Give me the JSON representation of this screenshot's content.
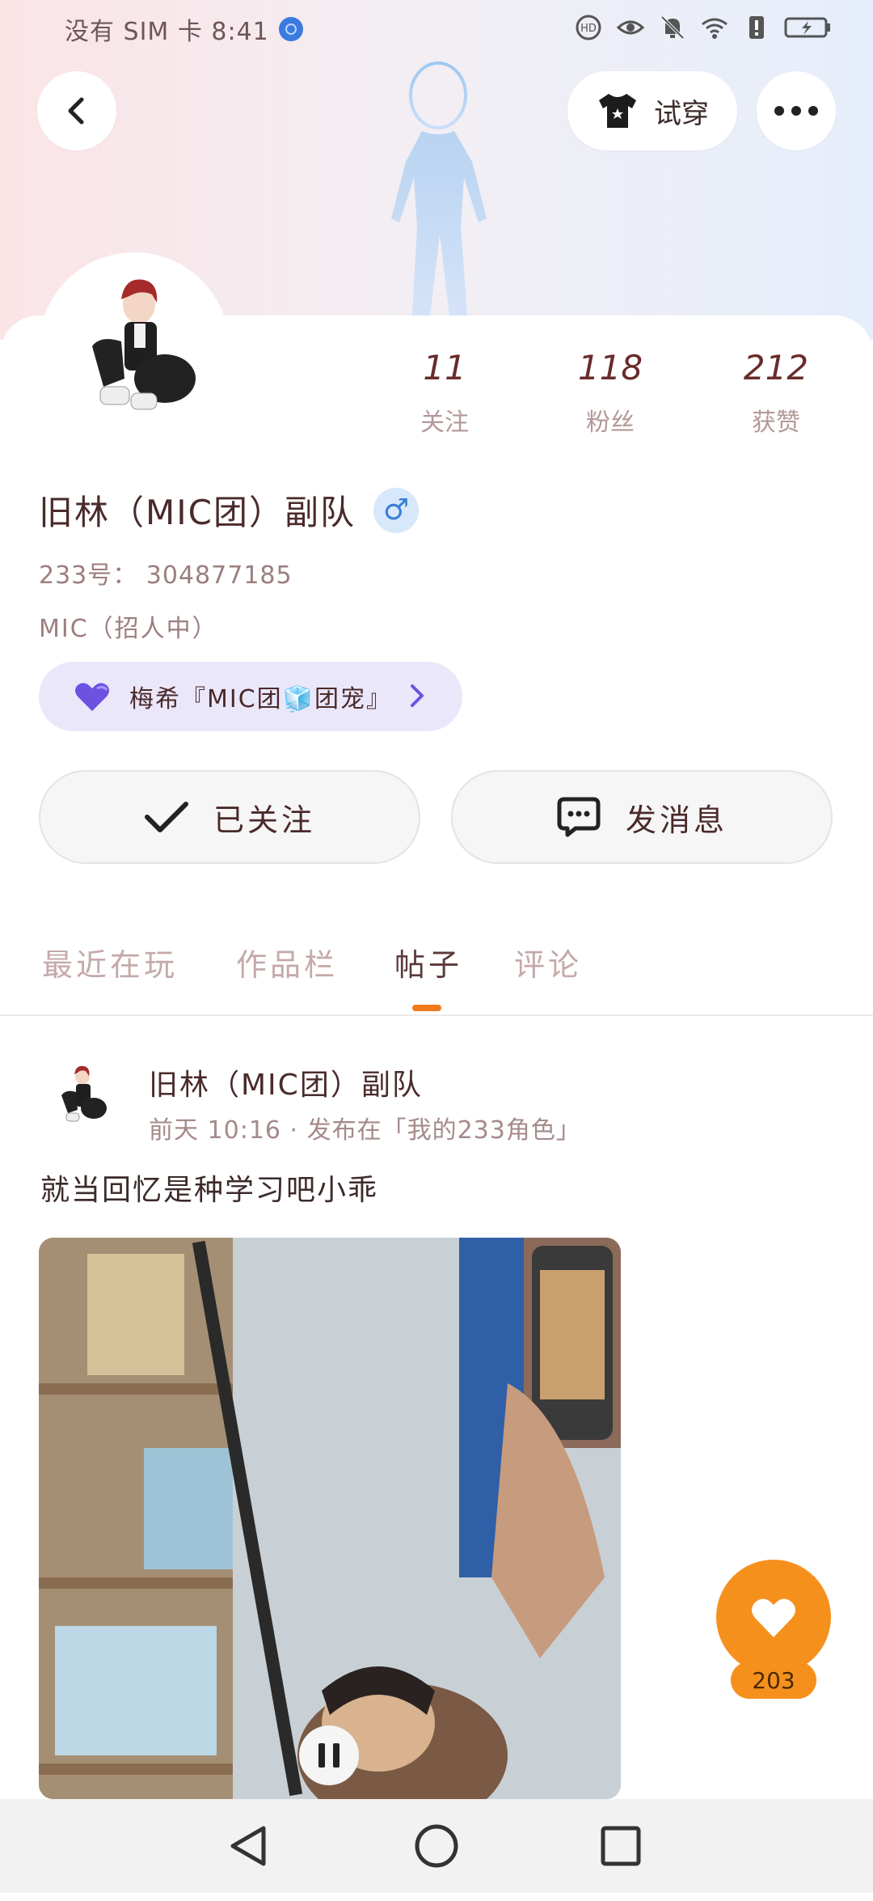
{
  "status_bar": {
    "carrier_time": "没有 SIM 卡 8:41",
    "icons": [
      "hd-icon",
      "eye-icon",
      "bell-off-icon",
      "wifi-icon",
      "alert-icon",
      "battery-icon"
    ]
  },
  "header": {
    "try_on_label": "试穿"
  },
  "profile": {
    "stats": [
      {
        "num": "11",
        "label": "关注"
      },
      {
        "num": "118",
        "label": "粉丝"
      },
      {
        "num": "212",
        "label": "获赞"
      }
    ],
    "name": "旧林（MIC团）副队",
    "gender_symbol": "♂",
    "id_line": "233号： 304877185",
    "bio": "MIC（招人中）",
    "group_label": "梅希『MIC团🧊团宠』",
    "follow_label": "已关注",
    "message_label": "发消息"
  },
  "tabs": [
    {
      "label": "最近在玩"
    },
    {
      "label": "作品栏"
    },
    {
      "label": "帖子"
    },
    {
      "label": "评论"
    }
  ],
  "post": {
    "author": "旧林（MIC团）副队",
    "meta": "前天 10:16 · 发布在「我的233角色」",
    "text": "就当回忆是种学习吧小乖",
    "like_count": "203"
  },
  "colors": {
    "accent": "#f6901d",
    "tab_indicator": "#f07a1c",
    "pill_bg": "#ebe7fb",
    "gender_blue": "#3b7fd6"
  }
}
